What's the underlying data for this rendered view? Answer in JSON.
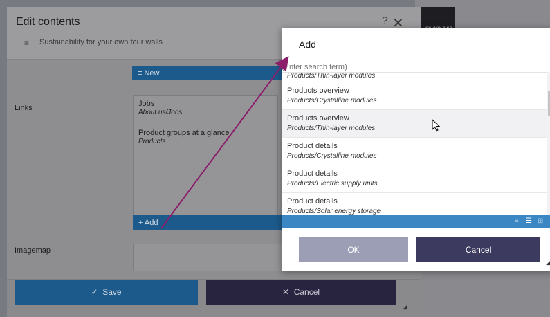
{
  "background": {
    "snippet": "es are also"
  },
  "edit_dialog": {
    "title": "Edit contents",
    "help": "?",
    "subtitle": "Sustainability for your own four walls",
    "new_label": "New",
    "links_label": "Links",
    "links": [
      {
        "title": "Jobs",
        "path": "About us/Jobs"
      },
      {
        "title": "Product groups at a glance",
        "path": "Products"
      }
    ],
    "add_label": "Add",
    "imagemap_label": "Imagemap",
    "save_label": "Save",
    "cancel_label": "Cancel"
  },
  "add_dialog": {
    "title": "Add",
    "search_placeholder": "(Enter search term)",
    "partial_top_path": "Products/Thin-layer modules",
    "results": [
      {
        "title": "Products overview",
        "path": "Products/Crystalline modules"
      },
      {
        "title": "Products overview",
        "path": "Products/Thin-layer modules"
      },
      {
        "title": "Product details",
        "path": "Products/Crystalline modules"
      },
      {
        "title": "Product details",
        "path": "Products/Electric supply units"
      },
      {
        "title": "Product details",
        "path": "Products/Solar energy storage"
      }
    ],
    "ok_label": "OK",
    "cancel_label": "Cancel"
  },
  "colors": {
    "accent": "#3b87c4",
    "annotation_arrow": "#8b1d6b"
  }
}
